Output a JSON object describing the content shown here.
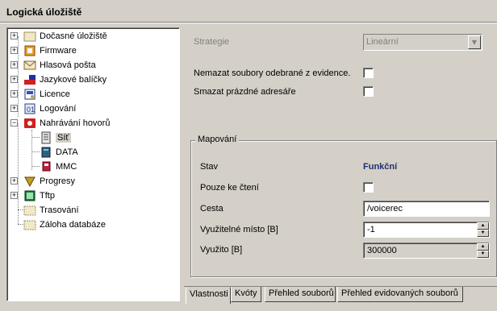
{
  "title": "Logická úložiště",
  "tree": {
    "items": [
      {
        "label": "Dočasné úložiště",
        "icon": "storage-icon",
        "expander": "+"
      },
      {
        "label": "Firmware",
        "icon": "firmware-chip-icon",
        "expander": "+"
      },
      {
        "label": "Hlasová pošta",
        "icon": "envelope-icon",
        "expander": "+"
      },
      {
        "label": "Jazykové balíčky",
        "icon": "language-flag-icon",
        "expander": "+"
      },
      {
        "label": "Licence",
        "icon": "certificate-icon",
        "expander": "+"
      },
      {
        "label": "Logování",
        "icon": "log-icon",
        "expander": "+"
      },
      {
        "label": "Nahrávání hovorů",
        "icon": "recording-icon",
        "expander": "−"
      },
      {
        "label": "Síť",
        "icon": "network-share-icon",
        "expander": ""
      },
      {
        "label": "DATA",
        "icon": "data-drive-icon",
        "expander": ""
      },
      {
        "label": "MMC",
        "icon": "mmc-card-icon",
        "expander": ""
      },
      {
        "label": "Progresy",
        "icon": "progress-icon",
        "expander": "+"
      },
      {
        "label": "Tftp",
        "icon": "tftp-icon",
        "expander": "+"
      },
      {
        "label": "Trasování",
        "icon": "trace-folder-icon",
        "expander": ""
      },
      {
        "label": "Záloha databáze",
        "icon": "backup-folder-icon",
        "expander": ""
      }
    ]
  },
  "form": {
    "strategy_label": "Strategie",
    "strategy_value": "Lineární",
    "no_delete_label": "Nemazat soubory odebrané z evidence.",
    "delete_empty_label": "Smazat prázdné adresáře"
  },
  "mapping": {
    "group_title": "Mapování",
    "state_label": "Stav",
    "state_value": "Funkční",
    "readonly_label": "Pouze ke čtení",
    "path_label": "Cesta",
    "path_value": "/voicerec",
    "usable_label": "Využitelné místo [B]",
    "usable_value": "-1",
    "used_label": "Využito [B]",
    "used_value": "300000"
  },
  "tabs": [
    "Vlastnosti",
    "Kvóty",
    "Přehled souborů",
    "Přehled evidovaných souborů"
  ],
  "colors": {
    "state_value": "#1f2f6f",
    "background": "#d4d0c8"
  }
}
